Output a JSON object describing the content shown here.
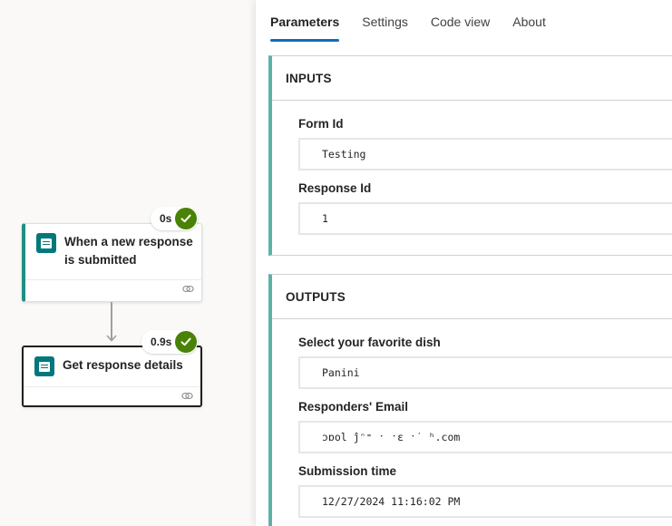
{
  "flow": {
    "trigger": {
      "title": "When a new response is submitted",
      "duration": "0s",
      "status": "succeeded"
    },
    "action": {
      "title": "Get response details",
      "duration": "0.9s",
      "status": "succeeded"
    }
  },
  "panel": {
    "tabs": [
      {
        "label": "Parameters",
        "active": true
      },
      {
        "label": "Settings",
        "active": false
      },
      {
        "label": "Code view",
        "active": false
      },
      {
        "label": "About",
        "active": false
      }
    ],
    "inputs": {
      "header": "INPUTS",
      "fields": [
        {
          "label": "Form Id",
          "value": "Testing"
        },
        {
          "label": "Response Id",
          "value": "1"
        }
      ]
    },
    "outputs": {
      "header": "OUTPUTS",
      "fields": [
        {
          "label": "Select your favorite dish",
          "value": "Panini"
        },
        {
          "label": "Responders' Email",
          "value": "ɔɒol ĵᵔ⁼ ˑ   ˑɛ ˑ˙ ʰ.com"
        },
        {
          "label": "Submission time",
          "value": "12/27/2024 11:16:02 PM"
        }
      ]
    }
  },
  "colors": {
    "accent": "#0f6cbd",
    "success": "#498205",
    "forms": "#03787c",
    "section_bar": "#5db2a8"
  }
}
